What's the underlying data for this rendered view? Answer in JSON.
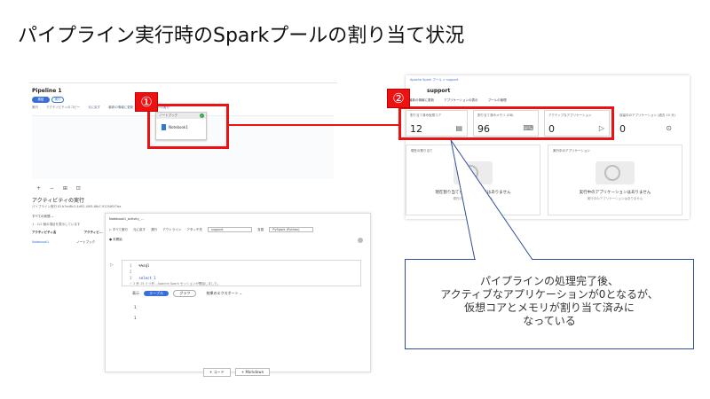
{
  "slide": {
    "title": "パイプライン実行時のSparkプールの割り当て状況"
  },
  "badges": {
    "one": "①",
    "two": "②"
  },
  "pipeline": {
    "title": "Pipeline 1",
    "tabs": [
      "検証",
      "実行"
    ],
    "toolbar": [
      "実行",
      "アクティビティのコピー",
      "元に戻す",
      "最新の情報に更新",
      "パイプラインの実行"
    ],
    "activity": {
      "type": "ノートブック",
      "name": "Notebook1"
    }
  },
  "spark": {
    "breadcrumb": "Apache Spark プール > support",
    "title": "support",
    "toolbar": [
      "最新の情報に更新",
      "アプリケーションの表示",
      "プールの管理"
    ],
    "metrics": [
      {
        "label": "割り当て済み仮想コア",
        "value": "12",
        "icon": "▤"
      },
      {
        "label": "割り当て済みメモリ (GB)",
        "value": "96",
        "icon": "⌨"
      },
      {
        "label": "アクティブなアプリケーション",
        "value": "0",
        "icon": "▷"
      },
      {
        "label": "保留中のアプリケーション (過去 15 分)",
        "value": "0",
        "icon": "⊙"
      }
    ],
    "panels": [
      {
        "title": "現在の割り当て",
        "message": "現在割り当てられているコアはありません",
        "sub": "現在の割り当てはありません"
      },
      {
        "title": "実行中のアプリケーション",
        "message": "実行中のアプリケーションはありません",
        "sub": "実行中のアプリケーションはありません"
      }
    ]
  },
  "runs": {
    "tools": "+ − ⊞ ⊡",
    "title": "アクティビティの実行",
    "subtitle": "パイプライン実行 ID b7ed8c3-4d92-40f5-8fb7-912f4f0f7da",
    "filter": "すべての状態 ⌄",
    "count": "1 - 1/1 個の項目を表示しています",
    "headers": [
      "アクティビティ名",
      "アクティビ..."
    ],
    "row": {
      "name": "Notebook1",
      "type": "ノートブック"
    }
  },
  "notebook": {
    "tab": "Notebook1_activity_...",
    "toolbar": [
      "▷ すべて実行",
      "元に戻す",
      "発行",
      "アウトライン",
      "アタッチ先"
    ],
    "attach": "support",
    "lang_label": "言語",
    "lang": "PySpark (Python)",
    "status": "● 未開始",
    "code": [
      {
        "n": "1",
        "text": "%%sql"
      },
      {
        "n": "2",
        "text": ""
      },
      {
        "n": "3",
        "text": "select 1"
      }
    ],
    "log": "✓ 2 秒 15 ミリ秒 - Apache Spark セッションが開始しました。",
    "result_label": "表示",
    "result_table": "テーブル",
    "result_chart": "グラフ",
    "export": "結果のエクスポート ⌄",
    "results": [
      "1",
      "1"
    ],
    "add_code": "+ コード",
    "add_md": "+ Markdown"
  },
  "callout": {
    "text": "パイプラインの処理完了後、\nアクティブなアプリケーションが0となるが、\n仮想コアとメモリが割り当て済みに\nなっている"
  },
  "colors": {
    "highlight": "#ee1111",
    "accent": "#3b6fd6",
    "callout_border": "#2f4f9a"
  }
}
